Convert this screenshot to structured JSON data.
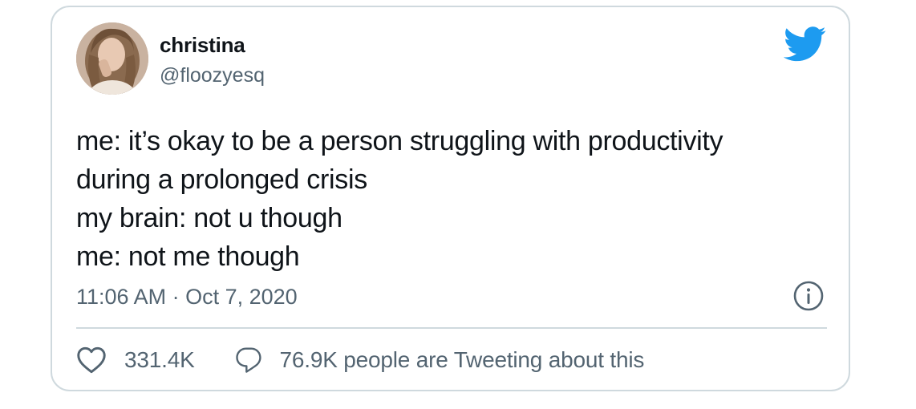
{
  "author": {
    "name": "christina",
    "handle": "@floozyesq",
    "avatar_icon": "profile-photo"
  },
  "tweet": {
    "lines": [
      "me: it’s okay to be a person struggling with productivity",
      "during a prolonged crisis",
      "my brain: not u though",
      "me: not me though"
    ],
    "timestamp": "11:06 AM · Oct 7, 2020"
  },
  "actions": {
    "like_count": "331.4K",
    "conversation_text": "76.9K people are Tweeting about this"
  },
  "icons": {
    "brand": "twitter-bird-icon",
    "info": "info-icon",
    "like": "heart-icon",
    "reply": "speech-bubble-icon"
  },
  "colors": {
    "brand": "#1d9bf0",
    "text_primary": "#0f1419",
    "text_secondary": "#536471",
    "border": "#cfd9de"
  }
}
